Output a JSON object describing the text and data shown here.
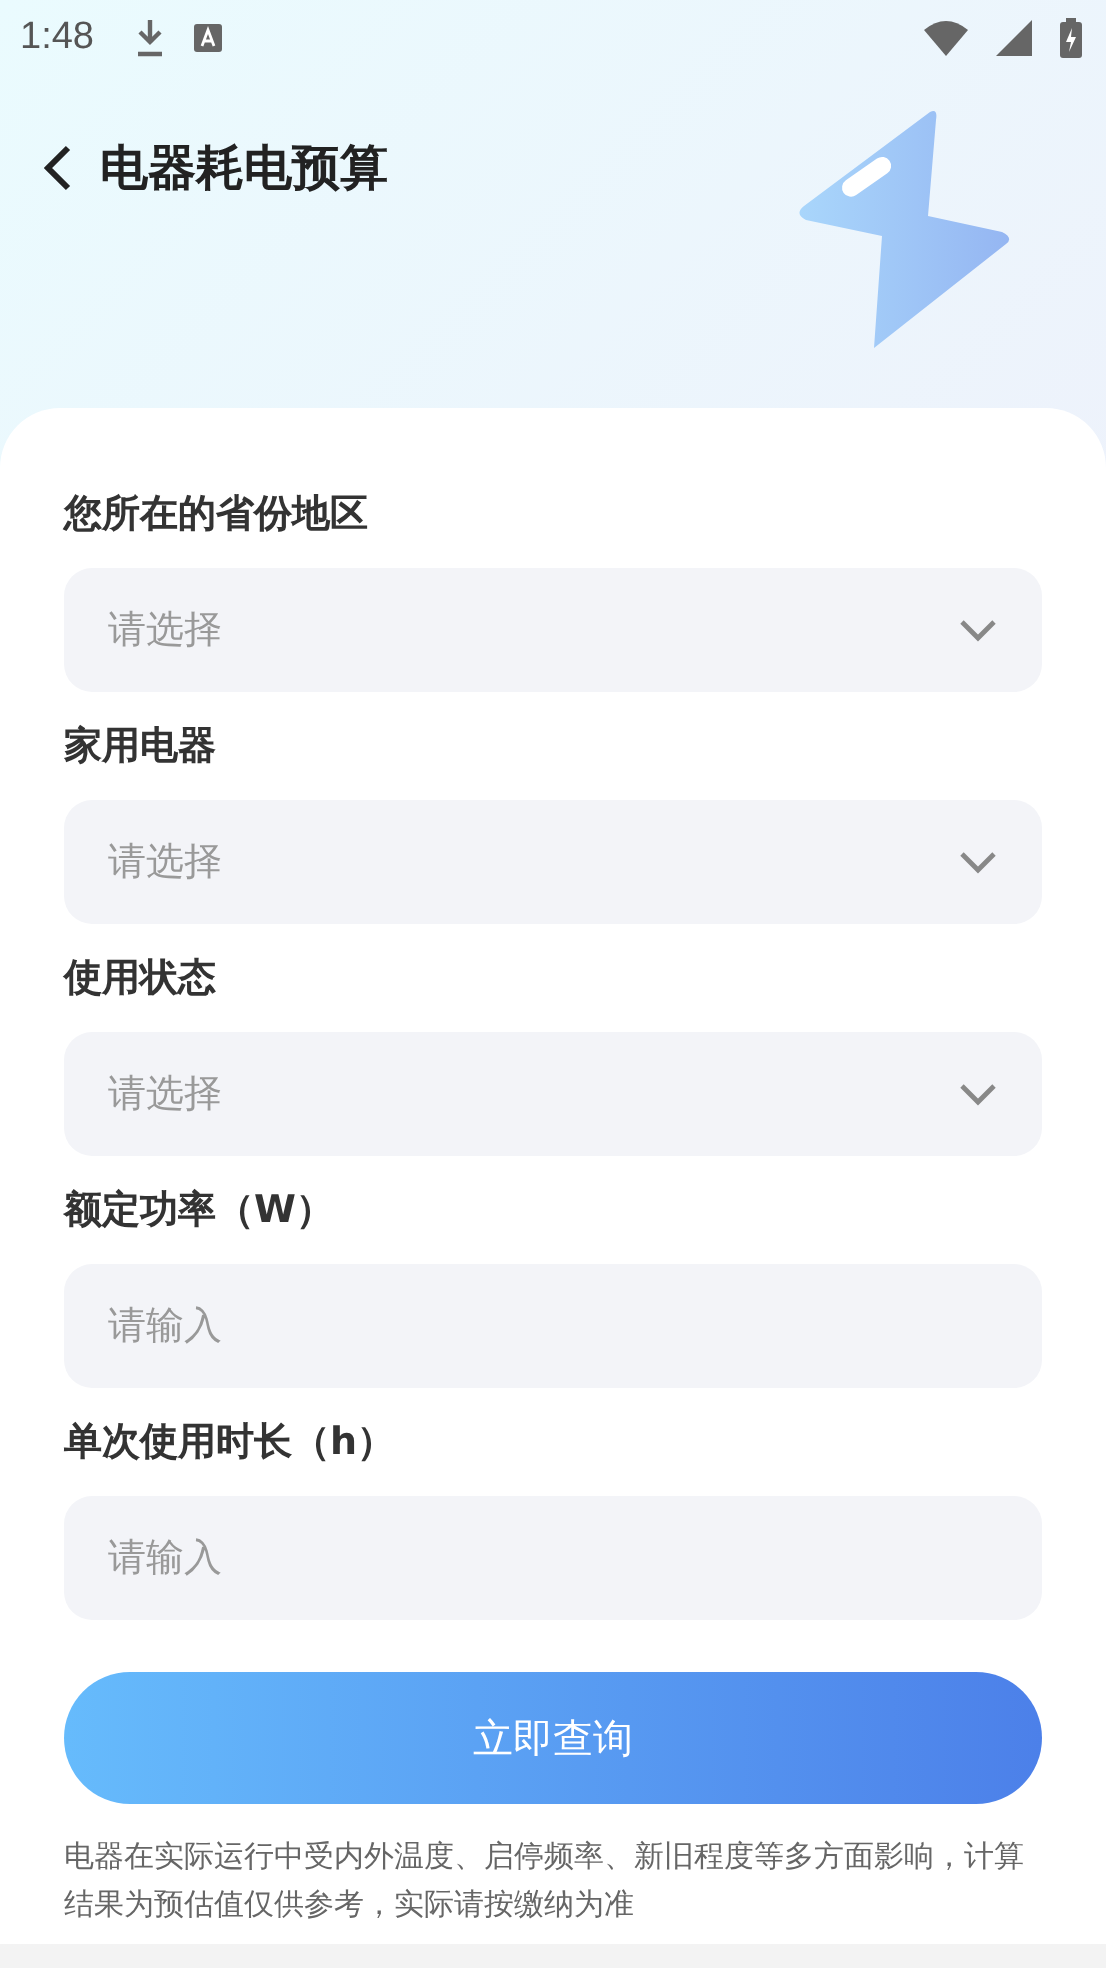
{
  "status_bar": {
    "time": "1:48"
  },
  "header": {
    "title": "电器耗电预算"
  },
  "fields": [
    {
      "kind": "select",
      "label": "您所在的省份地区",
      "placeholder": "请选择"
    },
    {
      "kind": "select",
      "label": "家用电器",
      "placeholder": "请选择"
    },
    {
      "kind": "select",
      "label": "使用状态",
      "placeholder": "请选择"
    },
    {
      "kind": "input",
      "label": "额定功率（W）",
      "placeholder": "请输入"
    },
    {
      "kind": "input",
      "label": "单次使用时长（h）",
      "placeholder": "请输入"
    }
  ],
  "submit_button": "立即查询",
  "note": "电器在实际运行中受内外温度、启停频率、新旧程度等多方面影响，计算结果为预估值仅供参考，实际请按缴纳为准"
}
